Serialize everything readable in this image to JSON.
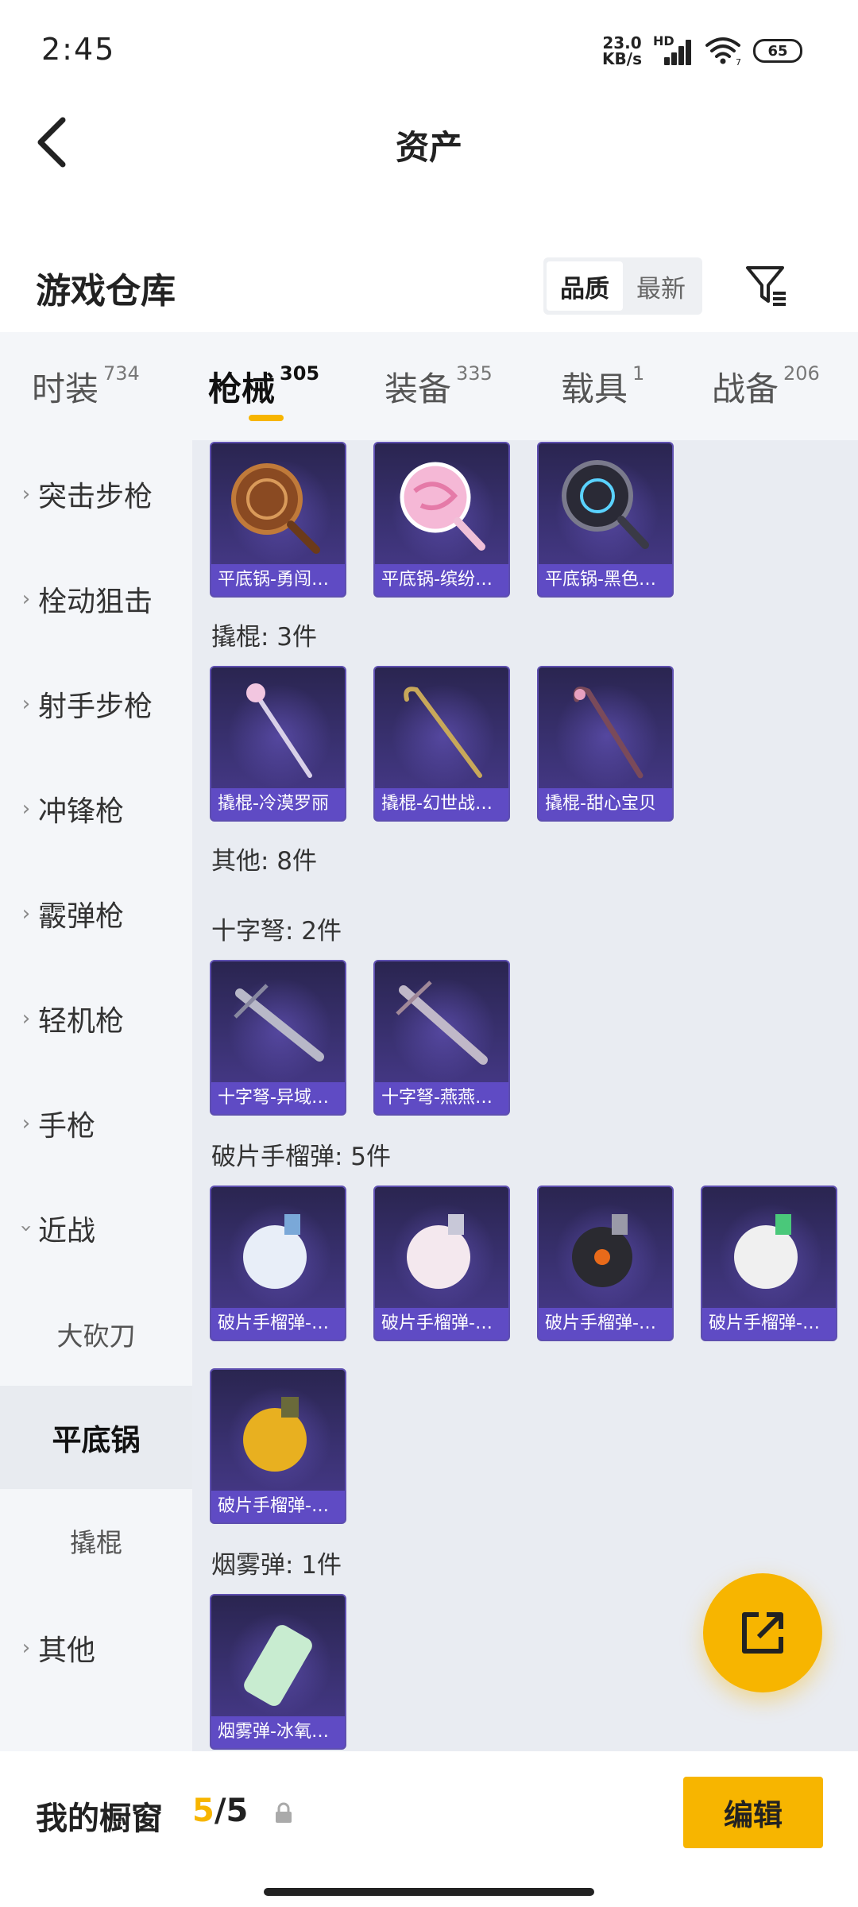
{
  "status_bar": {
    "time": "2:45",
    "net_speed_value": "23.0",
    "net_speed_unit": "KB/s",
    "network_type": "HD",
    "wifi_badge": "7",
    "battery": "65"
  },
  "nav": {
    "title": "资产"
  },
  "warehouse": {
    "title": "游戏仓库",
    "sort_options": [
      "品质",
      "最新"
    ],
    "sort_selected": "品质"
  },
  "tabs": [
    {
      "label": "时装",
      "count": "734"
    },
    {
      "label": "枪械",
      "count": "305",
      "active": true
    },
    {
      "label": "装备",
      "count": "335"
    },
    {
      "label": "载具",
      "count": "1"
    },
    {
      "label": "战备",
      "count": "206"
    }
  ],
  "sidebar": {
    "categories": [
      {
        "label": "突击步枪"
      },
      {
        "label": "栓动狙击"
      },
      {
        "label": "射手步枪"
      },
      {
        "label": "冲锋枪"
      },
      {
        "label": "霰弹枪"
      },
      {
        "label": "轻机枪"
      },
      {
        "label": "手枪"
      },
      {
        "label": "近战",
        "expanded": true
      },
      {
        "label": "其他"
      }
    ],
    "subcategories": [
      {
        "label": "大砍刀"
      },
      {
        "label": "平底锅",
        "selected": true
      },
      {
        "label": "撬棍"
      }
    ]
  },
  "content": {
    "sections": [
      {
        "heading": "",
        "items": [
          "平底锅-勇闯…",
          "平底锅-缤纷…",
          "平底锅-黑色…"
        ]
      },
      {
        "heading": "撬棍: 3件",
        "items": [
          "撬棍-冷漠罗丽",
          "撬棍-幻世战…",
          "撬棍-甜心宝贝"
        ]
      },
      {
        "heading": "其他: 8件",
        "items": []
      },
      {
        "heading": "十字弩: 2件",
        "items": [
          "十字弩-异域…",
          "十字弩-燕燕…"
        ]
      },
      {
        "heading": "破片手榴弹: 5件",
        "items": [
          "破片手榴弹-…",
          "破片手榴弹-…",
          "破片手榴弹-…",
          "破片手榴弹-…",
          "破片手榴弹-…"
        ]
      },
      {
        "heading": "烟雾弹: 1件",
        "items": [
          "烟雾弹-冰氧…"
        ]
      }
    ]
  },
  "bottom": {
    "showcase_label": "我的橱窗",
    "showcase_current": "5",
    "showcase_sep": "/",
    "showcase_max": "5",
    "edit_label": "编辑"
  },
  "colors": {
    "accent": "#f7b500",
    "item_bg": "#3b3274",
    "item_caption": "#5f4bc4"
  }
}
